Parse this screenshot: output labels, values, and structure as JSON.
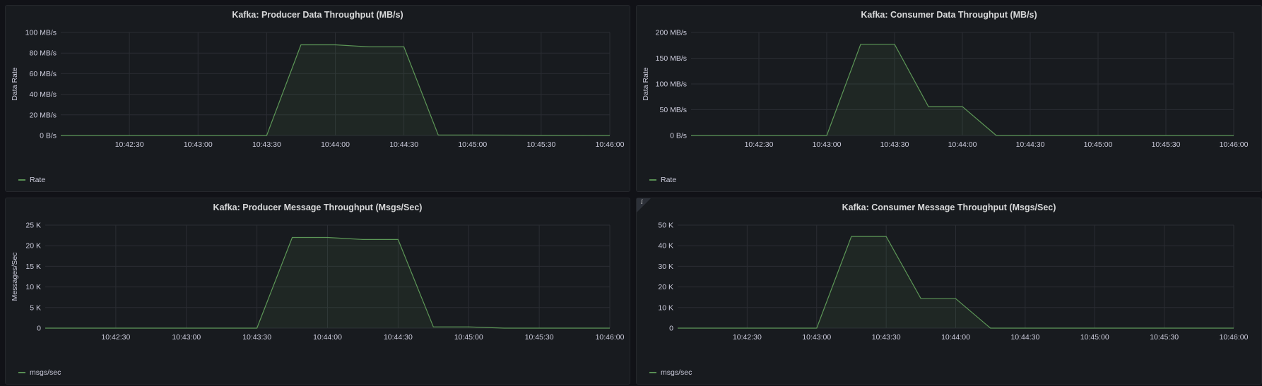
{
  "panels": [
    {
      "title": "Kafka: Producer Data Throughput (MB/s)",
      "legend": "Rate",
      "info": false
    },
    {
      "title": "Kafka: Consumer Data Throughput (MB/s)",
      "legend": "Rate",
      "info": false
    },
    {
      "title": "Kafka: Producer Message Throughput (Msgs/Sec)",
      "legend": "msgs/sec",
      "info": false
    },
    {
      "title": "Kafka: Consumer Message Throughput (Msgs/Sec)",
      "legend": "msgs/sec",
      "info": true
    }
  ],
  "colors": {
    "series": "#73bf69",
    "grid": "#2a2d33",
    "background": "#181b1f"
  },
  "chart_data": [
    {
      "type": "area",
      "title": "Kafka: Producer Data Throughput (MB/s)",
      "ylabel": "Data Rate",
      "xlabel": "",
      "xlim": [
        "10:42:00",
        "10:46:00"
      ],
      "ylim": [
        0,
        100
      ],
      "yticks": [
        0,
        20,
        40,
        60,
        80,
        100
      ],
      "ytick_labels": [
        "0 B/s",
        "20 MB/s",
        "40 MB/s",
        "60 MB/s",
        "80 MB/s",
        "100 MB/s"
      ],
      "xtick_labels": [
        "10:42:30",
        "10:43:00",
        "10:43:30",
        "10:44:00",
        "10:44:30",
        "10:45:00",
        "10:45:30",
        "10:46:00"
      ],
      "grid": true,
      "legend_position": "bottom-left",
      "series": [
        {
          "name": "Rate",
          "x": [
            "10:42:00",
            "10:43:30",
            "10:43:45",
            "10:44:00",
            "10:44:15",
            "10:44:30",
            "10:44:45",
            "10:45:00",
            "10:46:00"
          ],
          "y": [
            0,
            0,
            88,
            88,
            86,
            86,
            0.5,
            0.5,
            0
          ]
        }
      ]
    },
    {
      "type": "area",
      "title": "Kafka: Consumer Data Throughput (MB/s)",
      "ylabel": "Data Rate",
      "xlabel": "",
      "xlim": [
        "10:42:00",
        "10:46:00"
      ],
      "ylim": [
        0,
        200
      ],
      "yticks": [
        0,
        50,
        100,
        150,
        200
      ],
      "ytick_labels": [
        "0 B/s",
        "50 MB/s",
        "100 MB/s",
        "150 MB/s",
        "200 MB/s"
      ],
      "xtick_labels": [
        "10:42:30",
        "10:43:00",
        "10:43:30",
        "10:44:00",
        "10:44:30",
        "10:45:00",
        "10:45:30",
        "10:46:00"
      ],
      "grid": true,
      "legend_position": "bottom-left",
      "series": [
        {
          "name": "Rate",
          "x": [
            "10:42:00",
            "10:43:00",
            "10:43:15",
            "10:43:30",
            "10:43:45",
            "10:44:00",
            "10:44:15",
            "10:46:00"
          ],
          "y": [
            0,
            0,
            177,
            177,
            56,
            56,
            0,
            0
          ]
        }
      ]
    },
    {
      "type": "area",
      "title": "Kafka: Producer Message Throughput (Msgs/Sec)",
      "ylabel": "Messages/Sec",
      "xlabel": "",
      "xlim": [
        "10:42:00",
        "10:46:00"
      ],
      "ylim": [
        0,
        25000
      ],
      "yticks": [
        0,
        5000,
        10000,
        15000,
        20000,
        25000
      ],
      "ytick_labels": [
        "0",
        "5 K",
        "10 K",
        "15 K",
        "20 K",
        "25 K"
      ],
      "xtick_labels": [
        "10:42:30",
        "10:43:00",
        "10:43:30",
        "10:44:00",
        "10:44:30",
        "10:45:00",
        "10:45:30",
        "10:46:00"
      ],
      "grid": true,
      "legend_position": "bottom-left",
      "series": [
        {
          "name": "msgs/sec",
          "x": [
            "10:42:00",
            "10:43:30",
            "10:43:45",
            "10:44:00",
            "10:44:15",
            "10:44:30",
            "10:44:45",
            "10:45:00",
            "10:45:15",
            "10:46:00"
          ],
          "y": [
            0,
            0,
            22000,
            22000,
            21500,
            21500,
            300,
            300,
            0,
            0
          ]
        }
      ]
    },
    {
      "type": "area",
      "title": "Kafka: Consumer Message Throughput (Msgs/Sec)",
      "ylabel": "",
      "xlabel": "",
      "xlim": [
        "10:42:00",
        "10:46:00"
      ],
      "ylim": [
        0,
        50000
      ],
      "yticks": [
        0,
        10000,
        20000,
        30000,
        40000,
        50000
      ],
      "ytick_labels": [
        "0",
        "10 K",
        "20 K",
        "30 K",
        "40 K",
        "50 K"
      ],
      "xtick_labels": [
        "10:42:30",
        "10:43:00",
        "10:43:30",
        "10:44:00",
        "10:44:30",
        "10:45:00",
        "10:45:30",
        "10:46:00"
      ],
      "grid": true,
      "legend_position": "bottom-left",
      "series": [
        {
          "name": "msgs/sec",
          "x": [
            "10:42:00",
            "10:43:00",
            "10:43:15",
            "10:43:30",
            "10:43:45",
            "10:44:00",
            "10:44:15",
            "10:46:00"
          ],
          "y": [
            0,
            0,
            44500,
            44500,
            14300,
            14300,
            0,
            0
          ]
        }
      ]
    }
  ]
}
